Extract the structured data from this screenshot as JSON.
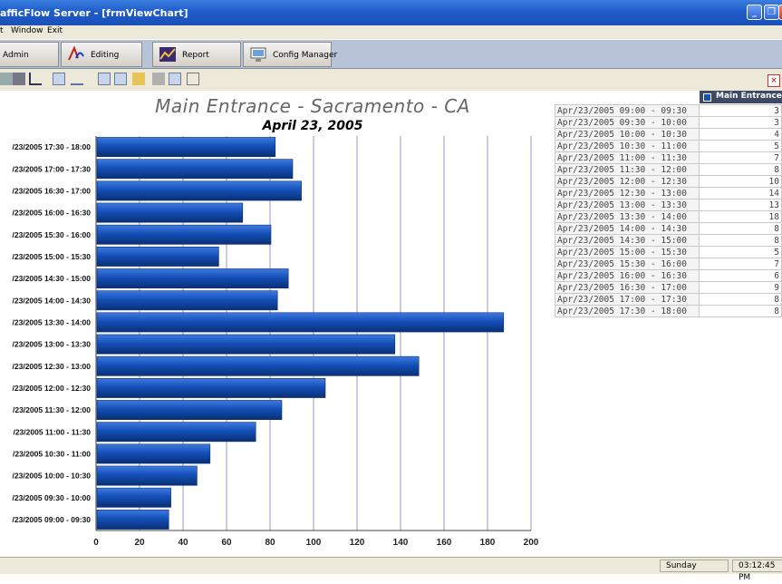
{
  "window": {
    "title": "afficFlow Server - [frmViewChart]"
  },
  "menu": [
    "t",
    "Window",
    "Exit"
  ],
  "tabs": [
    {
      "label": "Admin"
    },
    {
      "label": "Editing"
    },
    {
      "label": "Report"
    },
    {
      "label": "Config Manager"
    }
  ],
  "toolbar_icons": [
    "print-preview-icon",
    "print-icon",
    "chart-type-icon",
    "chart-3d-icon",
    "pen-icon",
    "legend-icon",
    "data-table-icon",
    "open-folder-icon",
    "save-icon",
    "copy-icon",
    "grid-icon"
  ],
  "legend": {
    "label": "Main Entrance"
  },
  "table": [
    {
      "label": "Apr/23/2005 09:00 - 09:30",
      "value": "3"
    },
    {
      "label": "Apr/23/2005 09:30 - 10:00",
      "value": "3"
    },
    {
      "label": "Apr/23/2005 10:00 - 10:30",
      "value": "4"
    },
    {
      "label": "Apr/23/2005 10:30 - 11:00",
      "value": "5"
    },
    {
      "label": "Apr/23/2005 11:00 - 11:30",
      "value": "7"
    },
    {
      "label": "Apr/23/2005 11:30 - 12:00",
      "value": "8"
    },
    {
      "label": "Apr/23/2005 12:00 - 12:30",
      "value": "10"
    },
    {
      "label": "Apr/23/2005 12:30 - 13:00",
      "value": "14"
    },
    {
      "label": "Apr/23/2005 13:00 - 13:30",
      "value": "13"
    },
    {
      "label": "Apr/23/2005 13:30 - 14:00",
      "value": "18"
    },
    {
      "label": "Apr/23/2005 14:00 - 14:30",
      "value": "8"
    },
    {
      "label": "Apr/23/2005 14:30 - 15:00",
      "value": "8"
    },
    {
      "label": "Apr/23/2005 15:00 - 15:30",
      "value": "5"
    },
    {
      "label": "Apr/23/2005 15:30 - 16:00",
      "value": "7"
    },
    {
      "label": "Apr/23/2005 16:00 - 16:30",
      "value": "6"
    },
    {
      "label": "Apr/23/2005 16:30 - 17:00",
      "value": "9"
    },
    {
      "label": "Apr/23/2005 17:00 - 17:30",
      "value": "8"
    },
    {
      "label": "Apr/23/2005 17:30 - 18:00",
      "value": "8"
    }
  ],
  "status": {
    "day": "Sunday",
    "time": "03:12:45 PM"
  },
  "colors": {
    "bar": "#1450b8",
    "bar_dark": "#0a2f75",
    "grid": "#9a9ac8",
    "titlebar": "#1f5cc9"
  },
  "chart_data": {
    "type": "bar",
    "orientation": "horizontal",
    "title": "Main Entrance - Sacramento - CA",
    "subtitle": "April 23, 2005",
    "categories": [
      "/23/2005 17:30 - 18:00",
      "/23/2005 17:00 - 17:30",
      "/23/2005 16:30 - 17:00",
      "/23/2005 16:00 - 16:30",
      "/23/2005 15:30 - 16:00",
      "/23/2005 15:00 - 15:30",
      "/23/2005 14:30 - 15:00",
      "/23/2005 14:00 - 14:30",
      "/23/2005 13:30 - 14:00",
      "/23/2005 13:00 - 13:30",
      "/23/2005 12:30 - 13:00",
      "/23/2005 12:00 - 12:30",
      "/23/2005 11:30 - 12:00",
      "/23/2005 11:00 - 11:30",
      "/23/2005 10:30 - 11:00",
      "/23/2005 10:00 - 10:30",
      "/23/2005 09:30 - 10:00",
      "/23/2005 09:00 - 09:30"
    ],
    "values": [
      82,
      90,
      94,
      67,
      80,
      56,
      88,
      83,
      187,
      137,
      148,
      105,
      85,
      73,
      52,
      46,
      34,
      33
    ],
    "xlim": [
      0,
      200
    ],
    "xticks": [
      0,
      20,
      40,
      60,
      80,
      100,
      120,
      140,
      160,
      180,
      200
    ],
    "grid": true
  }
}
